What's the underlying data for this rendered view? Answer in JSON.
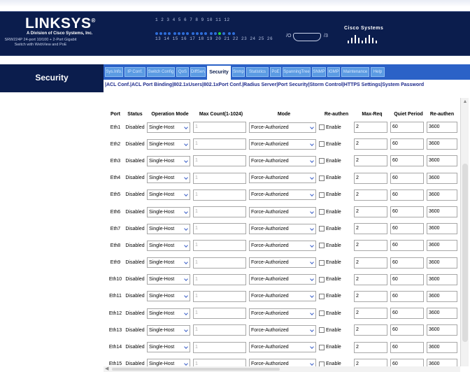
{
  "header": {
    "brand": "LINKSYS",
    "brand_tagline": "A Division of Cisco Systems, Inc.",
    "product_description": "SRW224P 24-port 10/100 + 2-Port Gigabit Switch with WebView and PoE",
    "port_numbers_top": "1 2 3 4   5 6 7 8   9 10 11 12",
    "port_numbers_bottom": "13 14 15 16   17 18 19 20   21 22 23 24   25 26",
    "console_left": "/O",
    "console_right": "/3",
    "cisco_label": "Cisco Systems"
  },
  "section": {
    "title": "Security"
  },
  "nav": {
    "tabs": [
      {
        "label": "Sys.Info."
      },
      {
        "label": "IP Conf."
      },
      {
        "label": "Switch Config"
      },
      {
        "label": "QoS"
      },
      {
        "label": "DiffServ"
      },
      {
        "label": "Security"
      },
      {
        "label": "Snmp"
      },
      {
        "label": "Statistics"
      },
      {
        "label": "PoE"
      },
      {
        "label": "SpanningTree"
      },
      {
        "label": "SNMP"
      },
      {
        "label": "IGMP"
      },
      {
        "label": "Maintenance"
      },
      {
        "label": "Help"
      }
    ],
    "active_tab": "Security"
  },
  "subnav": {
    "text": "|ACL Conf.|ACL Port Binding|802.1xUsers|802.1xPort Conf.|Radius Server|Port Security|Storm Control|HTTPS Settings|System Password"
  },
  "table": {
    "columns": {
      "port": "Port",
      "status": "Status",
      "operation_mode": "Operation Mode",
      "max_count": "Max Count(1-1024)",
      "mode": "Mode",
      "reauthen": "Re-authen",
      "max_req": "Max-Req",
      "quiet_period": "Quiet Period",
      "reauthen2": "Re-authen"
    },
    "rows": [
      {
        "port": "Eth1",
        "status": "Disabled",
        "operation_mode": "Single-Host",
        "max_count": "1",
        "mode": "Force-Authorized",
        "reauthen": "Enable",
        "max_req": "2",
        "quiet_period": "60",
        "reauth_period": "3600"
      },
      {
        "port": "Eth2",
        "status": "Disabled",
        "operation_mode": "Single-Host",
        "max_count": "1",
        "mode": "Force-Authorized",
        "reauthen": "Enable",
        "max_req": "2",
        "quiet_period": "60",
        "reauth_period": "3600"
      },
      {
        "port": "Eth3",
        "status": "Disabled",
        "operation_mode": "Single-Host",
        "max_count": "1",
        "mode": "Force-Authorized",
        "reauthen": "Enable",
        "max_req": "2",
        "quiet_period": "60",
        "reauth_period": "3600"
      },
      {
        "port": "Eth4",
        "status": "Disabled",
        "operation_mode": "Single-Host",
        "max_count": "1",
        "mode": "Force-Authorized",
        "reauthen": "Enable",
        "max_req": "2",
        "quiet_period": "60",
        "reauth_period": "3600"
      },
      {
        "port": "Eth5",
        "status": "Disabled",
        "operation_mode": "Single-Host",
        "max_count": "1",
        "mode": "Force-Authorized",
        "reauthen": "Enable",
        "max_req": "2",
        "quiet_period": "60",
        "reauth_period": "3600"
      },
      {
        "port": "Eth6",
        "status": "Disabled",
        "operation_mode": "Single-Host",
        "max_count": "1",
        "mode": "Force-Authorized",
        "reauthen": "Enable",
        "max_req": "2",
        "quiet_period": "60",
        "reauth_period": "3600"
      },
      {
        "port": "Eth7",
        "status": "Disabled",
        "operation_mode": "Single-Host",
        "max_count": "1",
        "mode": "Force-Authorized",
        "reauthen": "Enable",
        "max_req": "2",
        "quiet_period": "60",
        "reauth_period": "3600"
      },
      {
        "port": "Eth8",
        "status": "Disabled",
        "operation_mode": "Single-Host",
        "max_count": "1",
        "mode": "Force-Authorized",
        "reauthen": "Enable",
        "max_req": "2",
        "quiet_period": "60",
        "reauth_period": "3600"
      },
      {
        "port": "Eth9",
        "status": "Disabled",
        "operation_mode": "Single-Host",
        "max_count": "1",
        "mode": "Force-Authorized",
        "reauthen": "Enable",
        "max_req": "2",
        "quiet_period": "60",
        "reauth_period": "3600"
      },
      {
        "port": "Eth10",
        "status": "Disabled",
        "operation_mode": "Single-Host",
        "max_count": "1",
        "mode": "Force-Authorized",
        "reauthen": "Enable",
        "max_req": "2",
        "quiet_period": "60",
        "reauth_period": "3600"
      },
      {
        "port": "Eth11",
        "status": "Disabled",
        "operation_mode": "Single-Host",
        "max_count": "1",
        "mode": "Force-Authorized",
        "reauthen": "Enable",
        "max_req": "2",
        "quiet_period": "60",
        "reauth_period": "3600"
      },
      {
        "port": "Eth12",
        "status": "Disabled",
        "operation_mode": "Single-Host",
        "max_count": "1",
        "mode": "Force-Authorized",
        "reauthen": "Enable",
        "max_req": "2",
        "quiet_period": "60",
        "reauth_period": "3600"
      },
      {
        "port": "Eth13",
        "status": "Disabled",
        "operation_mode": "Single-Host",
        "max_count": "1",
        "mode": "Force-Authorized",
        "reauthen": "Enable",
        "max_req": "2",
        "quiet_period": "60",
        "reauth_period": "3600"
      },
      {
        "port": "Eth14",
        "status": "Disabled",
        "operation_mode": "Single-Host",
        "max_count": "1",
        "mode": "Force-Authorized",
        "reauthen": "Enable",
        "max_req": "2",
        "quiet_period": "60",
        "reauth_period": "3600"
      },
      {
        "port": "Eth15",
        "status": "Disabled",
        "operation_mode": "Single-Host",
        "max_count": "1",
        "mode": "Force-Authorized",
        "reauthen": "Enable",
        "max_req": "2",
        "quiet_period": "60",
        "reauth_period": "3600"
      }
    ]
  },
  "colors": {
    "header_navy": "#0b1d4d",
    "nav_blue": "#2b62c7",
    "tab_blue": "#5b9be3",
    "subnav_text": "#1f2b8c",
    "port_led_active": "#27d33c",
    "port_led_idle": "#2e6dd8"
  }
}
